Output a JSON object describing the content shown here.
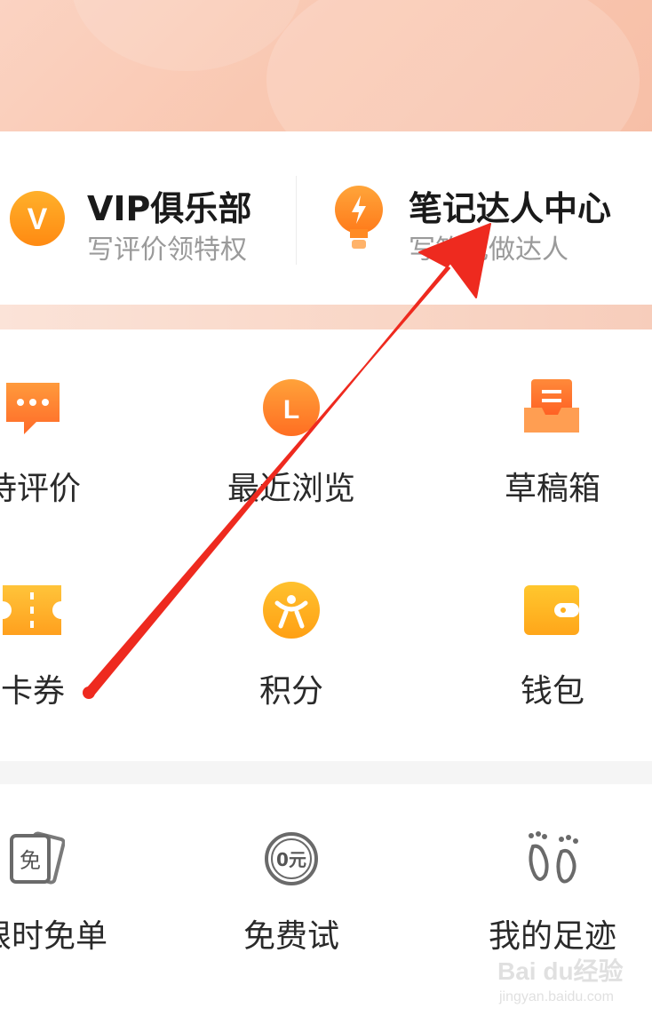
{
  "cards": {
    "vip": {
      "title": "VIP俱乐部",
      "subtitle": "写评价领特权",
      "icon": "vip-badge-icon",
      "icon_letter": "V"
    },
    "note": {
      "title": "笔记达人中心",
      "subtitle": "写笔记做达人",
      "icon": "lightbulb-icon"
    }
  },
  "grid": {
    "row1": [
      {
        "label": "待评价",
        "icon": "comment-bubble-icon"
      },
      {
        "label": "最近浏览",
        "icon": "clock-icon",
        "icon_letter": "L"
      },
      {
        "label": "草稿箱",
        "icon": "inbox-tray-icon"
      }
    ],
    "row2": [
      {
        "label": "卡券",
        "icon": "ticket-icon"
      },
      {
        "label": "积分",
        "icon": "points-person-icon"
      },
      {
        "label": "钱包",
        "icon": "wallet-icon"
      }
    ]
  },
  "services": [
    {
      "label": "限时免单",
      "icon": "free-voucher-icon",
      "icon_text": "免"
    },
    {
      "label": "免费试",
      "icon": "zero-yuan-icon",
      "icon_text": "0元"
    },
    {
      "label": "我的足迹",
      "icon": "footprints-icon"
    }
  ],
  "annotation": {
    "type": "red-arrow",
    "points_to": "笔记达人中心"
  },
  "watermark": {
    "text": "Bai du经验",
    "url": "jingyan.baidu.com"
  },
  "colors": {
    "accent_orange": "#ff8a1e",
    "arrow_red": "#ee2a1f",
    "label_dark": "#2a2a2a",
    "subtitle_gray": "#9a9a9a"
  }
}
